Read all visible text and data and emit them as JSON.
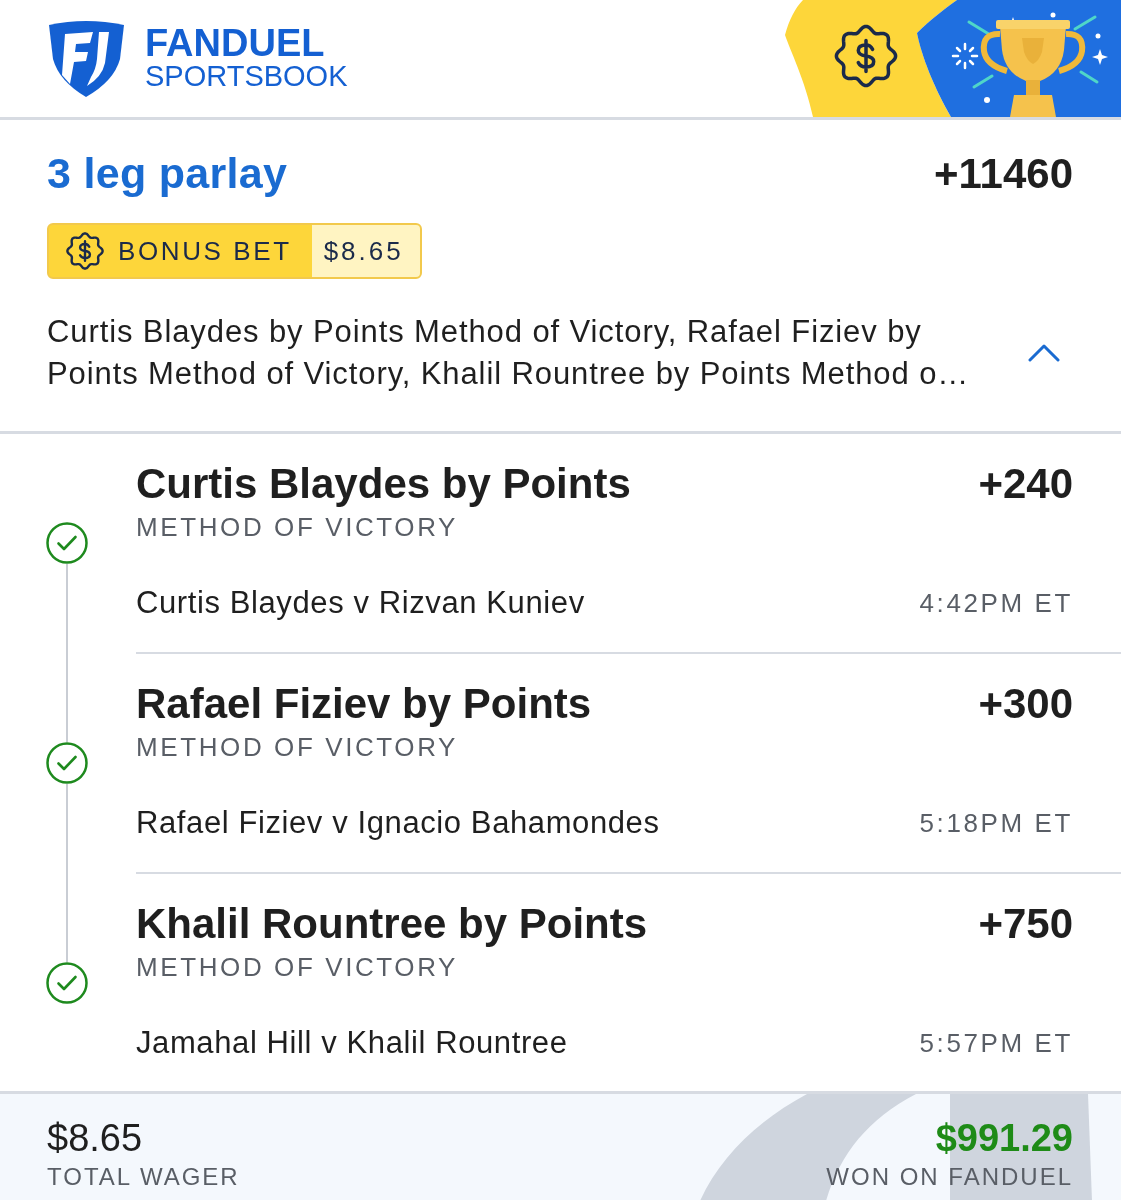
{
  "header": {
    "brand": "FANDUEL",
    "subbrand": "SPORTSBOOK"
  },
  "parlay": {
    "title": "3 leg parlay",
    "odds": "+11460",
    "bonus": {
      "label": "BONUS BET",
      "amount": "$8.65"
    },
    "summary": "Curtis Blaydes by Points Method of Victory, Rafael Fiziev by Points Method of Victory, Khalil Rountree by Points Method o…",
    "expanded": true
  },
  "legs": [
    {
      "selection": "Curtis Blaydes by Points",
      "odds": "+240",
      "market": "METHOD OF VICTORY",
      "event": "Curtis Blaydes v Rizvan Kuniev",
      "time": "4:42PM ET",
      "won": true
    },
    {
      "selection": "Rafael Fiziev by Points",
      "odds": "+300",
      "market": "METHOD OF VICTORY",
      "event": "Rafael Fiziev v Ignacio Bahamondes",
      "time": "5:18PM ET",
      "won": true
    },
    {
      "selection": "Khalil Rountree by Points",
      "odds": "+750",
      "market": "METHOD OF VICTORY",
      "event": "Jamahal Hill v Khalil Rountree",
      "time": "5:57PM ET",
      "won": true
    }
  ],
  "footer": {
    "wager": "$8.65",
    "wager_label": "TOTAL WAGER",
    "payout": "$991.29",
    "payout_label": "WON ON FANDUEL"
  }
}
